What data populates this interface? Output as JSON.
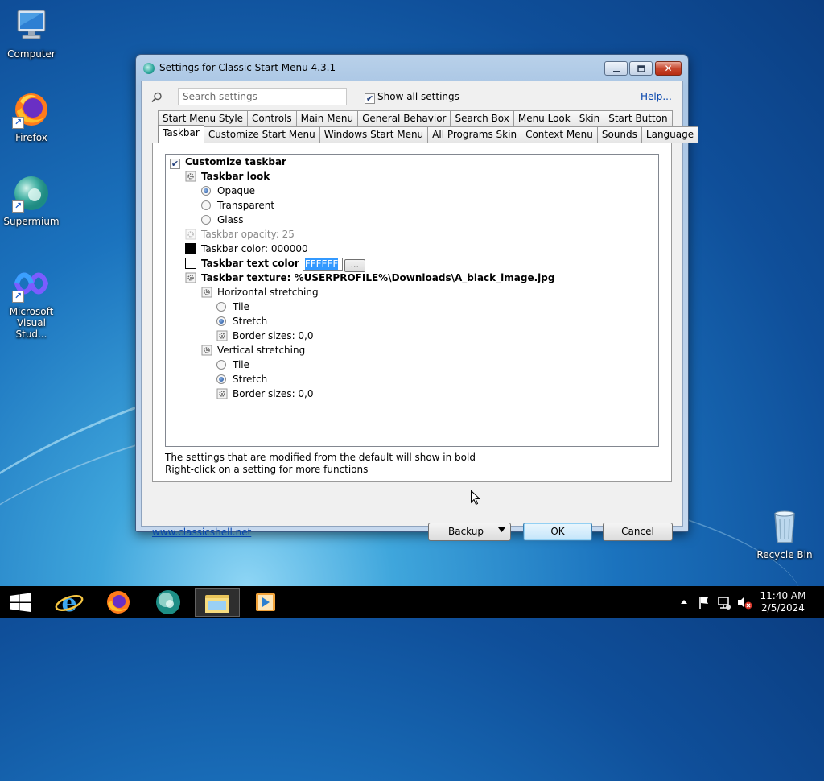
{
  "desktop": {
    "icons": [
      {
        "label": "Computer"
      },
      {
        "label": "Firefox"
      },
      {
        "label": "Supermium"
      },
      {
        "label": "Microsoft Visual Stud..."
      },
      {
        "label": "Recycle Bin"
      }
    ]
  },
  "window": {
    "title": "Settings for Classic Start Menu 4.3.1",
    "close_glyph": "✕",
    "search": {
      "placeholder": "Search settings",
      "value": ""
    },
    "show_all": {
      "label": "Show all settings",
      "checked": true
    },
    "help_link": "Help...",
    "tabs_row1": [
      "Start Menu Style",
      "Controls",
      "Main Menu",
      "General Behavior",
      "Search Box",
      "Menu Look",
      "Skin",
      "Start Button"
    ],
    "tabs_row2": [
      "Taskbar",
      "Customize Start Menu",
      "Windows Start Menu",
      "All Programs Skin",
      "Context Menu",
      "Sounds",
      "Language"
    ],
    "active_tab": "Taskbar",
    "tree": {
      "customize_taskbar": "Customize taskbar",
      "taskbar_look": "Taskbar look",
      "opaque": "Opaque",
      "transparent": "Transparent",
      "glass": "Glass",
      "opacity": "Taskbar opacity: 25",
      "color": "Taskbar color: 000000",
      "text_color_label": "Taskbar text color",
      "text_color_value": "FFFFFF",
      "ellipsis": "...",
      "texture": "Taskbar texture: %USERPROFILE%\\Downloads\\A_black_image.jpg",
      "horizontal": "Horizontal stretching",
      "h_tile": "Tile",
      "h_stretch": "Stretch",
      "h_border": "Border sizes: 0,0",
      "vertical": "Vertical stretching",
      "v_tile": "Tile",
      "v_stretch": "Stretch",
      "v_border": "Border sizes: 0,0"
    },
    "info_line1": "The settings that are modified from the default will show in bold",
    "info_line2": "Right-click on a setting for more functions",
    "footer_link": "www.classicshell.net",
    "buttons": {
      "backup": "Backup",
      "ok": "OK",
      "cancel": "Cancel"
    },
    "colors": {
      "taskbar_color": "#000000",
      "text_color": "#FFFFFF"
    }
  },
  "taskbar": {
    "clock_time": "11:40 AM",
    "clock_date": "2/5/2024"
  }
}
